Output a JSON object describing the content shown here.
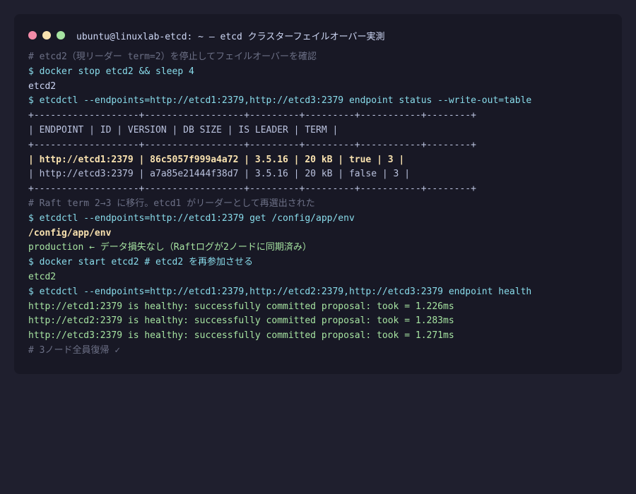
{
  "window": {
    "title": "ubuntu@linuxlab-etcd: ~ — etcd クラスターフェイルオーバー実測",
    "colors": {
      "close": "#f38ba8",
      "minimize": "#f9e2af",
      "maximize": "#a6e3a1"
    }
  },
  "terminal": {
    "lines": [
      {
        "kind": "comment",
        "text": "# etcd2（現リーダー term=2）を停止してフェイルオーバーを確認"
      },
      {
        "kind": "command",
        "text": "$ docker stop etcd2 && sleep 4"
      },
      {
        "kind": "output",
        "text": "etcd2"
      },
      {
        "kind": "command",
        "text": "$ etcdctl --endpoints=http://etcd1:2379,http://etcd3:2379 endpoint status --write-out=table"
      },
      {
        "kind": "table",
        "text": "+-------------------+------------------+---------+---------+-----------+--------+"
      },
      {
        "kind": "table",
        "text": "| ENDPOINT | ID | VERSION | DB SIZE | IS LEADER | TERM |"
      },
      {
        "kind": "table",
        "text": "+-------------------+------------------+---------+---------+-----------+--------+"
      },
      {
        "kind": "leader",
        "text": "| http://etcd1:2379 | 86c5057f999a4a72 | 3.5.16 | 20 kB | true | 3 |"
      },
      {
        "kind": "table",
        "text": "| http://etcd3:2379 | a7a85e21444f38d7 | 3.5.16 | 20 kB | false | 3 |"
      },
      {
        "kind": "table",
        "text": "+-------------------+------------------+---------+---------+-----------+--------+"
      },
      {
        "kind": "comment",
        "text": "# Raft term 2→3 に移行。etcd1 がリーダーとして再選出された"
      },
      {
        "kind": "command",
        "text": "$ etcdctl --endpoints=http://etcd1:2379 get /config/app/env"
      },
      {
        "kind": "key",
        "text": "/config/app/env"
      },
      {
        "kind": "success",
        "text": "production ← データ損失なし（Raftログが2ノードに同期済み）"
      },
      {
        "kind": "command",
        "text": "$ docker start etcd2 # etcd2 を再参加させる"
      },
      {
        "kind": "success",
        "text": "etcd2"
      },
      {
        "kind": "command",
        "text": "$ etcdctl --endpoints=http://etcd1:2379,http://etcd2:2379,http://etcd3:2379 endpoint health"
      },
      {
        "kind": "success",
        "text": "http://etcd1:2379 is healthy: successfully committed proposal: took = 1.226ms"
      },
      {
        "kind": "success",
        "text": "http://etcd2:2379 is healthy: successfully committed proposal: took = 1.283ms"
      },
      {
        "kind": "success",
        "text": "http://etcd3:2379 is healthy: successfully committed proposal: took = 1.271ms"
      },
      {
        "kind": "comment",
        "text": "# 3ノード全員復帰 ✓"
      }
    ]
  }
}
